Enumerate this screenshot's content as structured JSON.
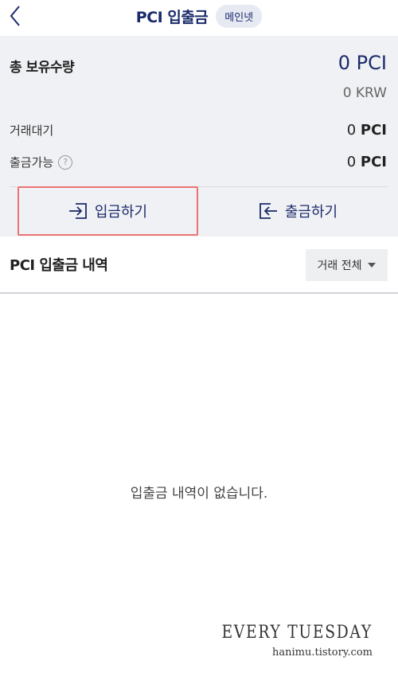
{
  "header": {
    "title": "PCI 입출금",
    "network_badge": "메인넷"
  },
  "summary": {
    "total_label": "총 보유수량",
    "total_amount": "0 PCI",
    "total_krw": "0 KRW",
    "rows": [
      {
        "label": "거래대기",
        "value_number": "0",
        "value_unit": "PCI"
      },
      {
        "label": "출금가능",
        "value_number": "0",
        "value_unit": "PCI"
      }
    ],
    "help_icon_glyph": "?"
  },
  "actions": {
    "deposit_label": "입금하기",
    "withdraw_label": "출금하기"
  },
  "history": {
    "title": "PCI 입출금 내역",
    "filter_label": "거래 전체",
    "empty_message": "입출금 내역이 없습니다."
  },
  "watermark": {
    "title": "EVERY TUESDAY",
    "url": "hanimu.tistory.com"
  },
  "colors": {
    "accent": "#1b2b6b",
    "highlight": "#ec7373",
    "panel_bg": "#f0f1f4"
  }
}
